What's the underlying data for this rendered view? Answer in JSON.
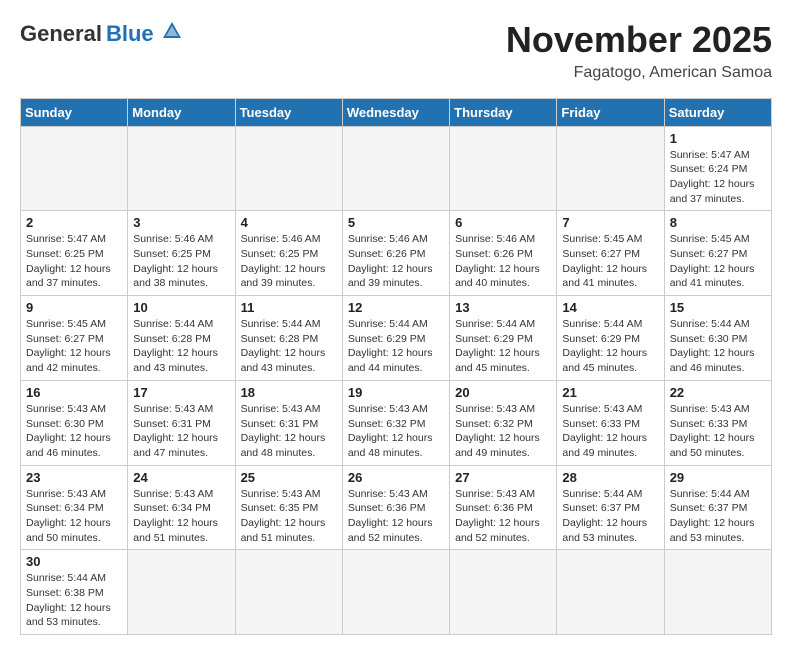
{
  "header": {
    "logo_general": "General",
    "logo_blue": "Blue",
    "month_title": "November 2025",
    "location": "Fagatogo, American Samoa"
  },
  "days_of_week": [
    "Sunday",
    "Monday",
    "Tuesday",
    "Wednesday",
    "Thursday",
    "Friday",
    "Saturday"
  ],
  "weeks": [
    [
      {
        "day": "",
        "info": ""
      },
      {
        "day": "",
        "info": ""
      },
      {
        "day": "",
        "info": ""
      },
      {
        "day": "",
        "info": ""
      },
      {
        "day": "",
        "info": ""
      },
      {
        "day": "",
        "info": ""
      },
      {
        "day": "1",
        "info": "Sunrise: 5:47 AM\nSunset: 6:24 PM\nDaylight: 12 hours and 37 minutes."
      }
    ],
    [
      {
        "day": "2",
        "info": "Sunrise: 5:47 AM\nSunset: 6:25 PM\nDaylight: 12 hours and 37 minutes."
      },
      {
        "day": "3",
        "info": "Sunrise: 5:46 AM\nSunset: 6:25 PM\nDaylight: 12 hours and 38 minutes."
      },
      {
        "day": "4",
        "info": "Sunrise: 5:46 AM\nSunset: 6:25 PM\nDaylight: 12 hours and 39 minutes."
      },
      {
        "day": "5",
        "info": "Sunrise: 5:46 AM\nSunset: 6:26 PM\nDaylight: 12 hours and 39 minutes."
      },
      {
        "day": "6",
        "info": "Sunrise: 5:46 AM\nSunset: 6:26 PM\nDaylight: 12 hours and 40 minutes."
      },
      {
        "day": "7",
        "info": "Sunrise: 5:45 AM\nSunset: 6:27 PM\nDaylight: 12 hours and 41 minutes."
      },
      {
        "day": "8",
        "info": "Sunrise: 5:45 AM\nSunset: 6:27 PM\nDaylight: 12 hours and 41 minutes."
      }
    ],
    [
      {
        "day": "9",
        "info": "Sunrise: 5:45 AM\nSunset: 6:27 PM\nDaylight: 12 hours and 42 minutes."
      },
      {
        "day": "10",
        "info": "Sunrise: 5:44 AM\nSunset: 6:28 PM\nDaylight: 12 hours and 43 minutes."
      },
      {
        "day": "11",
        "info": "Sunrise: 5:44 AM\nSunset: 6:28 PM\nDaylight: 12 hours and 43 minutes."
      },
      {
        "day": "12",
        "info": "Sunrise: 5:44 AM\nSunset: 6:29 PM\nDaylight: 12 hours and 44 minutes."
      },
      {
        "day": "13",
        "info": "Sunrise: 5:44 AM\nSunset: 6:29 PM\nDaylight: 12 hours and 45 minutes."
      },
      {
        "day": "14",
        "info": "Sunrise: 5:44 AM\nSunset: 6:29 PM\nDaylight: 12 hours and 45 minutes."
      },
      {
        "day": "15",
        "info": "Sunrise: 5:44 AM\nSunset: 6:30 PM\nDaylight: 12 hours and 46 minutes."
      }
    ],
    [
      {
        "day": "16",
        "info": "Sunrise: 5:43 AM\nSunset: 6:30 PM\nDaylight: 12 hours and 46 minutes."
      },
      {
        "day": "17",
        "info": "Sunrise: 5:43 AM\nSunset: 6:31 PM\nDaylight: 12 hours and 47 minutes."
      },
      {
        "day": "18",
        "info": "Sunrise: 5:43 AM\nSunset: 6:31 PM\nDaylight: 12 hours and 48 minutes."
      },
      {
        "day": "19",
        "info": "Sunrise: 5:43 AM\nSunset: 6:32 PM\nDaylight: 12 hours and 48 minutes."
      },
      {
        "day": "20",
        "info": "Sunrise: 5:43 AM\nSunset: 6:32 PM\nDaylight: 12 hours and 49 minutes."
      },
      {
        "day": "21",
        "info": "Sunrise: 5:43 AM\nSunset: 6:33 PM\nDaylight: 12 hours and 49 minutes."
      },
      {
        "day": "22",
        "info": "Sunrise: 5:43 AM\nSunset: 6:33 PM\nDaylight: 12 hours and 50 minutes."
      }
    ],
    [
      {
        "day": "23",
        "info": "Sunrise: 5:43 AM\nSunset: 6:34 PM\nDaylight: 12 hours and 50 minutes."
      },
      {
        "day": "24",
        "info": "Sunrise: 5:43 AM\nSunset: 6:34 PM\nDaylight: 12 hours and 51 minutes."
      },
      {
        "day": "25",
        "info": "Sunrise: 5:43 AM\nSunset: 6:35 PM\nDaylight: 12 hours and 51 minutes."
      },
      {
        "day": "26",
        "info": "Sunrise: 5:43 AM\nSunset: 6:36 PM\nDaylight: 12 hours and 52 minutes."
      },
      {
        "day": "27",
        "info": "Sunrise: 5:43 AM\nSunset: 6:36 PM\nDaylight: 12 hours and 52 minutes."
      },
      {
        "day": "28",
        "info": "Sunrise: 5:44 AM\nSunset: 6:37 PM\nDaylight: 12 hours and 53 minutes."
      },
      {
        "day": "29",
        "info": "Sunrise: 5:44 AM\nSunset: 6:37 PM\nDaylight: 12 hours and 53 minutes."
      }
    ],
    [
      {
        "day": "30",
        "info": "Sunrise: 5:44 AM\nSunset: 6:38 PM\nDaylight: 12 hours and 53 minutes."
      },
      {
        "day": "",
        "info": ""
      },
      {
        "day": "",
        "info": ""
      },
      {
        "day": "",
        "info": ""
      },
      {
        "day": "",
        "info": ""
      },
      {
        "day": "",
        "info": ""
      },
      {
        "day": "",
        "info": ""
      }
    ]
  ]
}
